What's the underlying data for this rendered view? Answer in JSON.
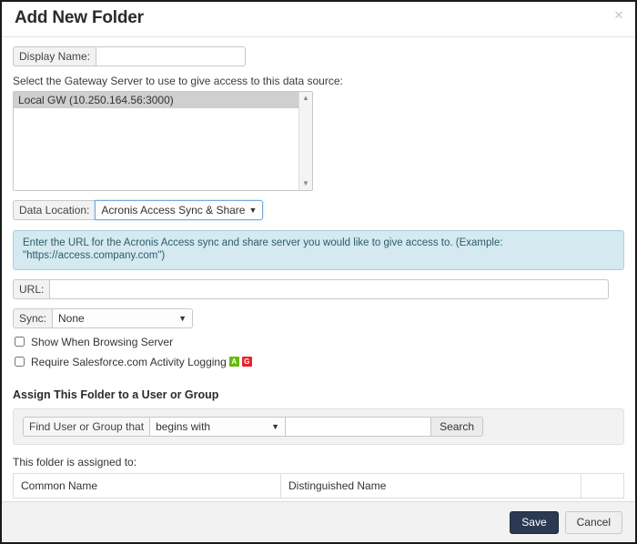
{
  "dialog": {
    "title": "Add New Folder",
    "close_label": "✕"
  },
  "form": {
    "display_name": {
      "label": "Display Name:",
      "value": "",
      "placeholder": ""
    },
    "gateway": {
      "helper_text": "Select the Gateway Server to use to give access to this data source:",
      "options": [
        "Local GW (10.250.164.56:3000)"
      ],
      "selected": "Local GW (10.250.164.56:3000)",
      "scroll_up_glyph": "▲",
      "scroll_down_glyph": "▼"
    },
    "data_location": {
      "label": "Data Location:",
      "selected": "Acronis Access Sync & Share",
      "options": [
        "Acronis Access Sync & Share"
      ],
      "caret": "▼"
    },
    "info_banner": {
      "text": "Enter the URL for the Acronis Access sync and share server you would like to give access to. (Example: \"https://access.company.com\")"
    },
    "url": {
      "label": "URL:",
      "value": "",
      "placeholder": ""
    },
    "sync": {
      "label": "Sync:",
      "selected": "None",
      "options": [
        "None"
      ],
      "caret": "▼"
    },
    "checkboxes": [
      {
        "label": "Show When Browsing Server",
        "checked": false,
        "badges": []
      },
      {
        "label": "Require Salesforce.com Activity Logging",
        "checked": false,
        "badges": [
          {
            "text": "A",
            "color": "#63b906"
          },
          {
            "text": "G",
            "color": "#e8252a"
          }
        ]
      }
    ]
  },
  "assign": {
    "section_title": "Assign This Folder to a User or Group",
    "find_label": "Find User or Group that",
    "scope_selected": "begins with",
    "scope_options": [
      "begins with"
    ],
    "scope_caret": "▼",
    "term_value": "",
    "term_placeholder": "",
    "search_button": "Search",
    "assigned_label": "This folder is assigned to:",
    "table": {
      "columns": [
        "Common Name",
        "Distinguished Name",
        ""
      ],
      "rows": []
    }
  },
  "footer": {
    "save_label": "Save",
    "cancel_label": "Cancel"
  }
}
